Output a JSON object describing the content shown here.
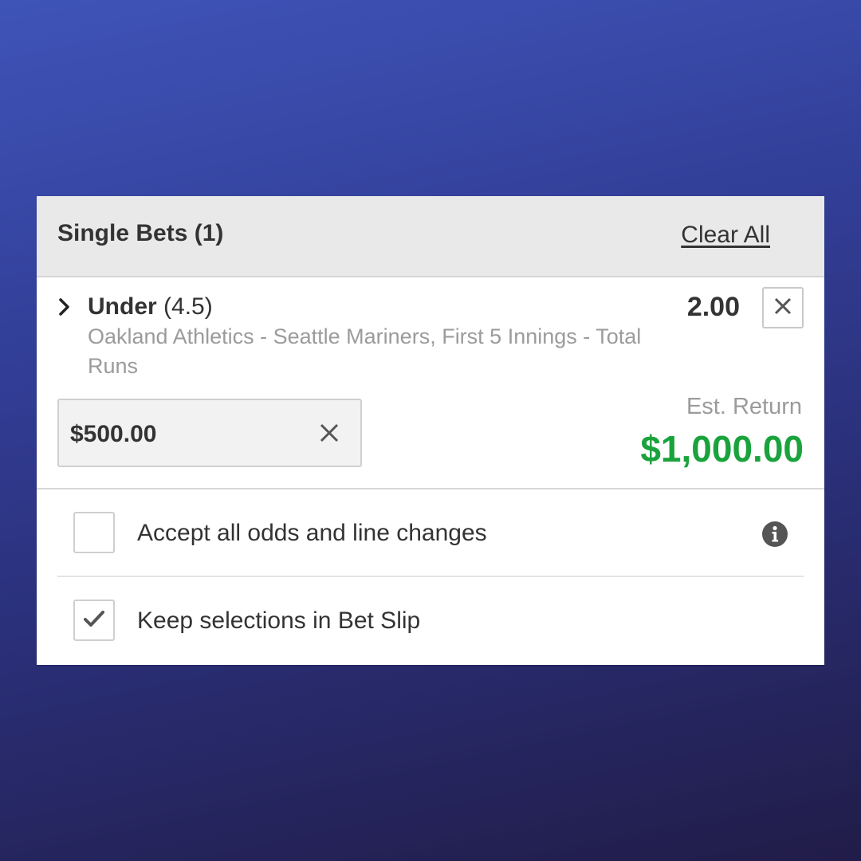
{
  "header": {
    "title": "Single Bets (1)",
    "clear_all_label": "Clear All"
  },
  "selection": {
    "market": "Under",
    "line": "(4.5)",
    "description": "Oakland Athletics - Seattle Mariners, First 5 Innings - Total Runs",
    "odds": "2.00",
    "expand_icon": "chevron-right-icon",
    "remove_icon": "close-icon"
  },
  "stake": {
    "value": "$500.00",
    "clear_icon": "close-icon"
  },
  "estimated_return": {
    "label": "Est. Return",
    "value": "$1,000.00",
    "color": "#1aa33c"
  },
  "options": [
    {
      "label": "Accept all odds and line changes",
      "checked": false,
      "icon": "info-icon"
    },
    {
      "label": "Keep selections in Bet Slip",
      "checked": true,
      "icon": "checkmark-icon"
    }
  ],
  "colors": {
    "header_background": "#e9e9e9",
    "text_primary": "#333333",
    "text_secondary": "#9b9b9b",
    "return_green": "#1aa33c"
  }
}
